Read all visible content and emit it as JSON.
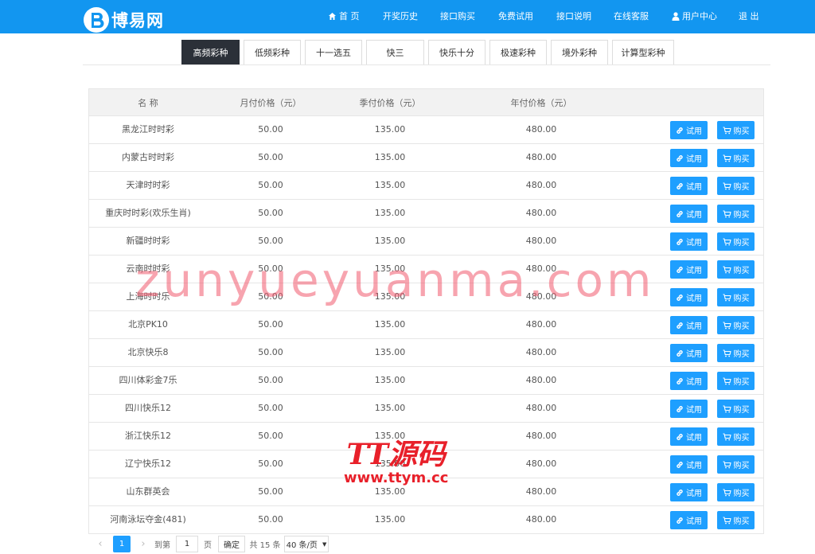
{
  "header": {
    "logo_text": "博易网",
    "nav": [
      {
        "label": "首 页",
        "icon": "home-icon"
      },
      {
        "label": "开奖历史"
      },
      {
        "label": "接口购买"
      },
      {
        "label": "免费试用"
      },
      {
        "label": "接口说明"
      },
      {
        "label": "在线客服"
      },
      {
        "label": "用户中心",
        "icon": "user-icon"
      },
      {
        "label": "退 出"
      }
    ]
  },
  "tabs": [
    "高频彩种",
    "低频彩种",
    "十一选五",
    "快三",
    "快乐十分",
    "极速彩种",
    "境外彩种",
    "计算型彩种"
  ],
  "table": {
    "headers": [
      "名 称",
      "月付价格（元）",
      "季付价格（元）",
      "年付价格（元）"
    ],
    "try_label": "试用",
    "buy_label": "购买",
    "rows": [
      {
        "name": "黑龙江时时彩",
        "month": "50.00",
        "quarter": "135.00",
        "year": "480.00"
      },
      {
        "name": "内蒙古时时彩",
        "month": "50.00",
        "quarter": "135.00",
        "year": "480.00"
      },
      {
        "name": "天津时时彩",
        "month": "50.00",
        "quarter": "135.00",
        "year": "480.00"
      },
      {
        "name": "重庆时时彩(欢乐生肖)",
        "month": "50.00",
        "quarter": "135.00",
        "year": "480.00"
      },
      {
        "name": "新疆时时彩",
        "month": "50.00",
        "quarter": "135.00",
        "year": "480.00"
      },
      {
        "name": "云南时时彩",
        "month": "50.00",
        "quarter": "135.00",
        "year": "480.00"
      },
      {
        "name": "上海时时乐",
        "month": "50.00",
        "quarter": "135.00",
        "year": "480.00"
      },
      {
        "name": "北京PK10",
        "month": "50.00",
        "quarter": "135.00",
        "year": "480.00"
      },
      {
        "name": "北京快乐8",
        "month": "50.00",
        "quarter": "135.00",
        "year": "480.00"
      },
      {
        "name": "四川体彩金7乐",
        "month": "50.00",
        "quarter": "135.00",
        "year": "480.00"
      },
      {
        "name": "四川快乐12",
        "month": "50.00",
        "quarter": "135.00",
        "year": "480.00"
      },
      {
        "name": "浙江快乐12",
        "month": "50.00",
        "quarter": "135.00",
        "year": "480.00"
      },
      {
        "name": "辽宁快乐12",
        "month": "50.00",
        "quarter": "135.00",
        "year": "480.00"
      },
      {
        "name": "山东群英会",
        "month": "50.00",
        "quarter": "135.00",
        "year": "480.00"
      },
      {
        "name": "河南泳坛夺金(481)",
        "month": "50.00",
        "quarter": "135.00",
        "year": "480.00"
      }
    ]
  },
  "pager": {
    "current": "1",
    "goto_label": "到第",
    "page_input": "1",
    "page_unit": "页",
    "confirm_label": "确定",
    "total_label": "共 15 条",
    "limit_label": "40 条/页"
  },
  "watermark": {
    "domain": "zunyueyuanma.com",
    "brand": "TT源码",
    "brand_url": "www.ttym.cc"
  }
}
